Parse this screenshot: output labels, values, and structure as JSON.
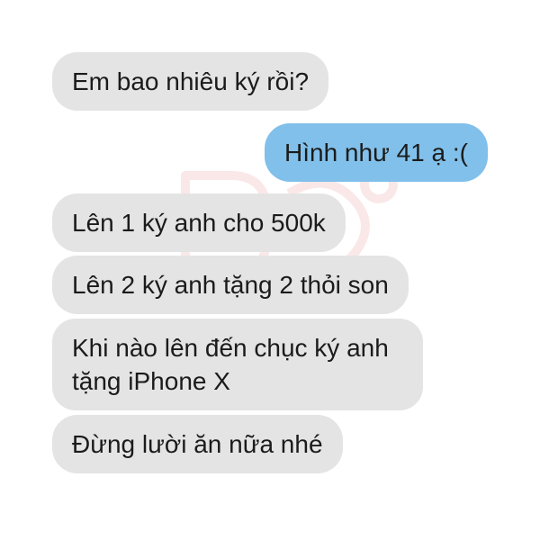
{
  "conversation": {
    "messages": [
      {
        "side": "received",
        "text": "Em bao nhiêu ký rồi?"
      },
      {
        "side": "sent",
        "text": "Hình như 41 ạ :("
      },
      {
        "side": "received",
        "text": "Lên 1 ký anh cho 500k"
      },
      {
        "side": "received",
        "text": "Lên 2 ký anh tặng 2 thỏi son"
      },
      {
        "side": "received",
        "text": "Khi nào lên đến chục ký anh tặng iPhone X"
      },
      {
        "side": "received",
        "text": "Đừng lười ăn nữa nhé"
      }
    ]
  },
  "colors": {
    "received_bubble": "#e4e4e4",
    "sent_bubble": "#81c0ea",
    "text": "#1b1b1b",
    "watermark": "#d94a4a"
  }
}
